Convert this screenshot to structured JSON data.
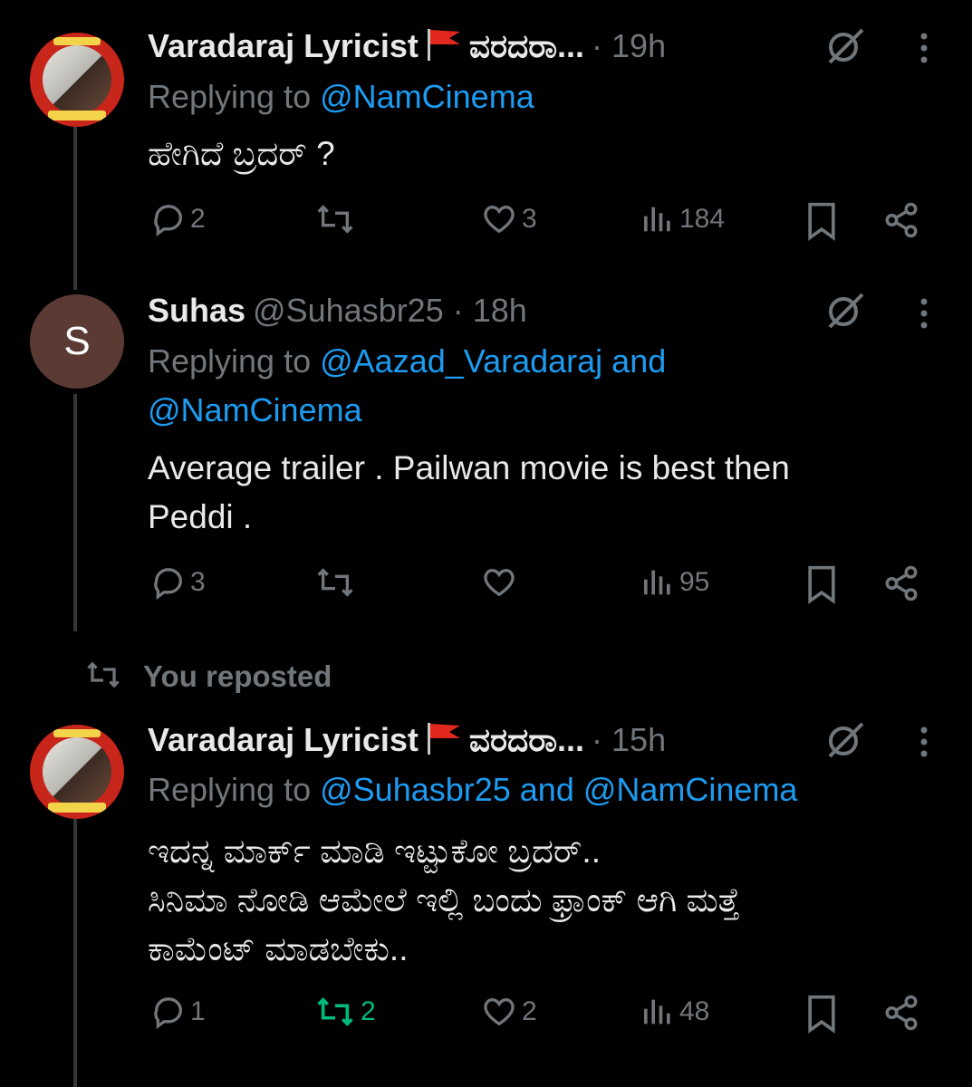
{
  "tweets": [
    {
      "name": "Varadaraj Lyricist",
      "name_suffix": "ವರದರಾ...",
      "meta": "· 19h",
      "replying_prefix": "Replying to ",
      "replying_mentions": "@NamCinema",
      "body_lines": [
        "ಹೇಗಿದೆ ಬ್ರದರ್ ?"
      ],
      "replies": "2",
      "reposts": "",
      "likes": "3",
      "views": "184"
    },
    {
      "name": "Suhas",
      "avatar_letter": "S",
      "meta": "@Suhasbr25 · 18h",
      "replying_prefix": "Replying to ",
      "replying_mentions_line1": "@Aazad_Varadaraj and",
      "replying_mentions_line2": "@NamCinema",
      "body_lines": [
        "Average trailer . Pailwan movie is best then",
        "Peddi ."
      ],
      "replies": "3",
      "reposts": "",
      "likes": "",
      "views": "95"
    },
    {
      "name": "Varadaraj Lyricist",
      "name_suffix": "ವರದರಾ...",
      "meta": "· 15h",
      "replying_prefix": "Replying to ",
      "replying_mentions": "@Suhasbr25 and @NamCinema",
      "body_lines": [
        "ಇದನ್ನ ಮಾರ್ಕ್ ಮಾಡಿ ಇಟ್ಟುಕೋ ಬ್ರದರ್..",
        "ಸಿನಿಮಾ ನೋಡಿ ಆಮೇಲೆ ಇಲ್ಲಿ ಬಂದು ಫ್ರಾಂಕ್ ಆಗಿ ಮತ್ತೆ",
        "ಕಾಮೆಂಟ್ ಮಾಡಬೇಕು.."
      ],
      "replies": "1",
      "reposts": "2",
      "likes": "2",
      "views": "48"
    }
  ],
  "repost_banner": {
    "label": "You reposted"
  },
  "icons": {
    "reply": "reply-icon",
    "repost": "repost-icon",
    "like": "like-icon",
    "views": "views-icon",
    "bookmark": "bookmark-icon",
    "share": "share-icon",
    "grok": "grok-icon",
    "more": "more-icon",
    "flag": "red-flag-emoji"
  },
  "colors": {
    "background": "#000000",
    "text": "#e7e9ea",
    "muted": "#71767b",
    "link": "#1d9bf0",
    "repost_active": "#00ba7c",
    "thread_line": "#333639"
  }
}
